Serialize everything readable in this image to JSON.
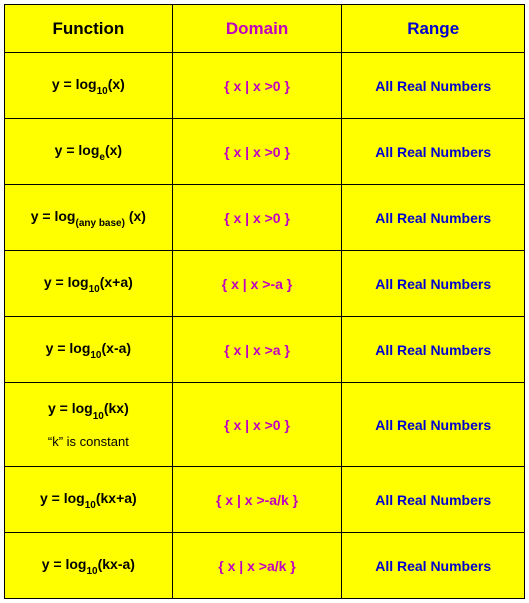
{
  "headers": {
    "function": "Function",
    "domain": "Domain",
    "range": "Range"
  },
  "rows": [
    {
      "func_pre": "y = log",
      "func_sub": "10",
      "func_post": "(x)",
      "note": "",
      "domain": "{ x  |  x >0 }",
      "range": "All Real Numbers"
    },
    {
      "func_pre": "y = log",
      "func_sub": "e",
      "func_post": "(x)",
      "note": "",
      "domain": "{ x  |  x >0 }",
      "range": "All Real Numbers"
    },
    {
      "func_pre": "y = log",
      "func_sub": "(any base)",
      "func_post": " (x)",
      "note": "",
      "domain": "{ x  |  x >0 }",
      "range": "All Real Numbers"
    },
    {
      "func_pre": "y = log",
      "func_sub": "10",
      "func_post": "(x+a)",
      "note": "",
      "domain": "{ x  |  x >-a }",
      "range": "All Real Numbers"
    },
    {
      "func_pre": "y = log",
      "func_sub": "10",
      "func_post": "(x-a)",
      "note": "",
      "domain": "{ x  |  x >a }",
      "range": "All Real Numbers"
    },
    {
      "func_pre": "y = log",
      "func_sub": "10",
      "func_post": "(kx)",
      "note": "“k” is constant",
      "domain": "{ x  |  x >0 }",
      "range": "All Real Numbers"
    },
    {
      "func_pre": "y = log",
      "func_sub": "10",
      "func_post": "(kx+a)",
      "note": "",
      "domain": "{ x  |  x >-a/k }",
      "range": "All Real Numbers"
    },
    {
      "func_pre": "y = log",
      "func_sub": "10",
      "func_post": "(kx-a)",
      "note": "",
      "domain": "{ x  |  x >a/k }",
      "range": "All Real Numbers"
    }
  ]
}
